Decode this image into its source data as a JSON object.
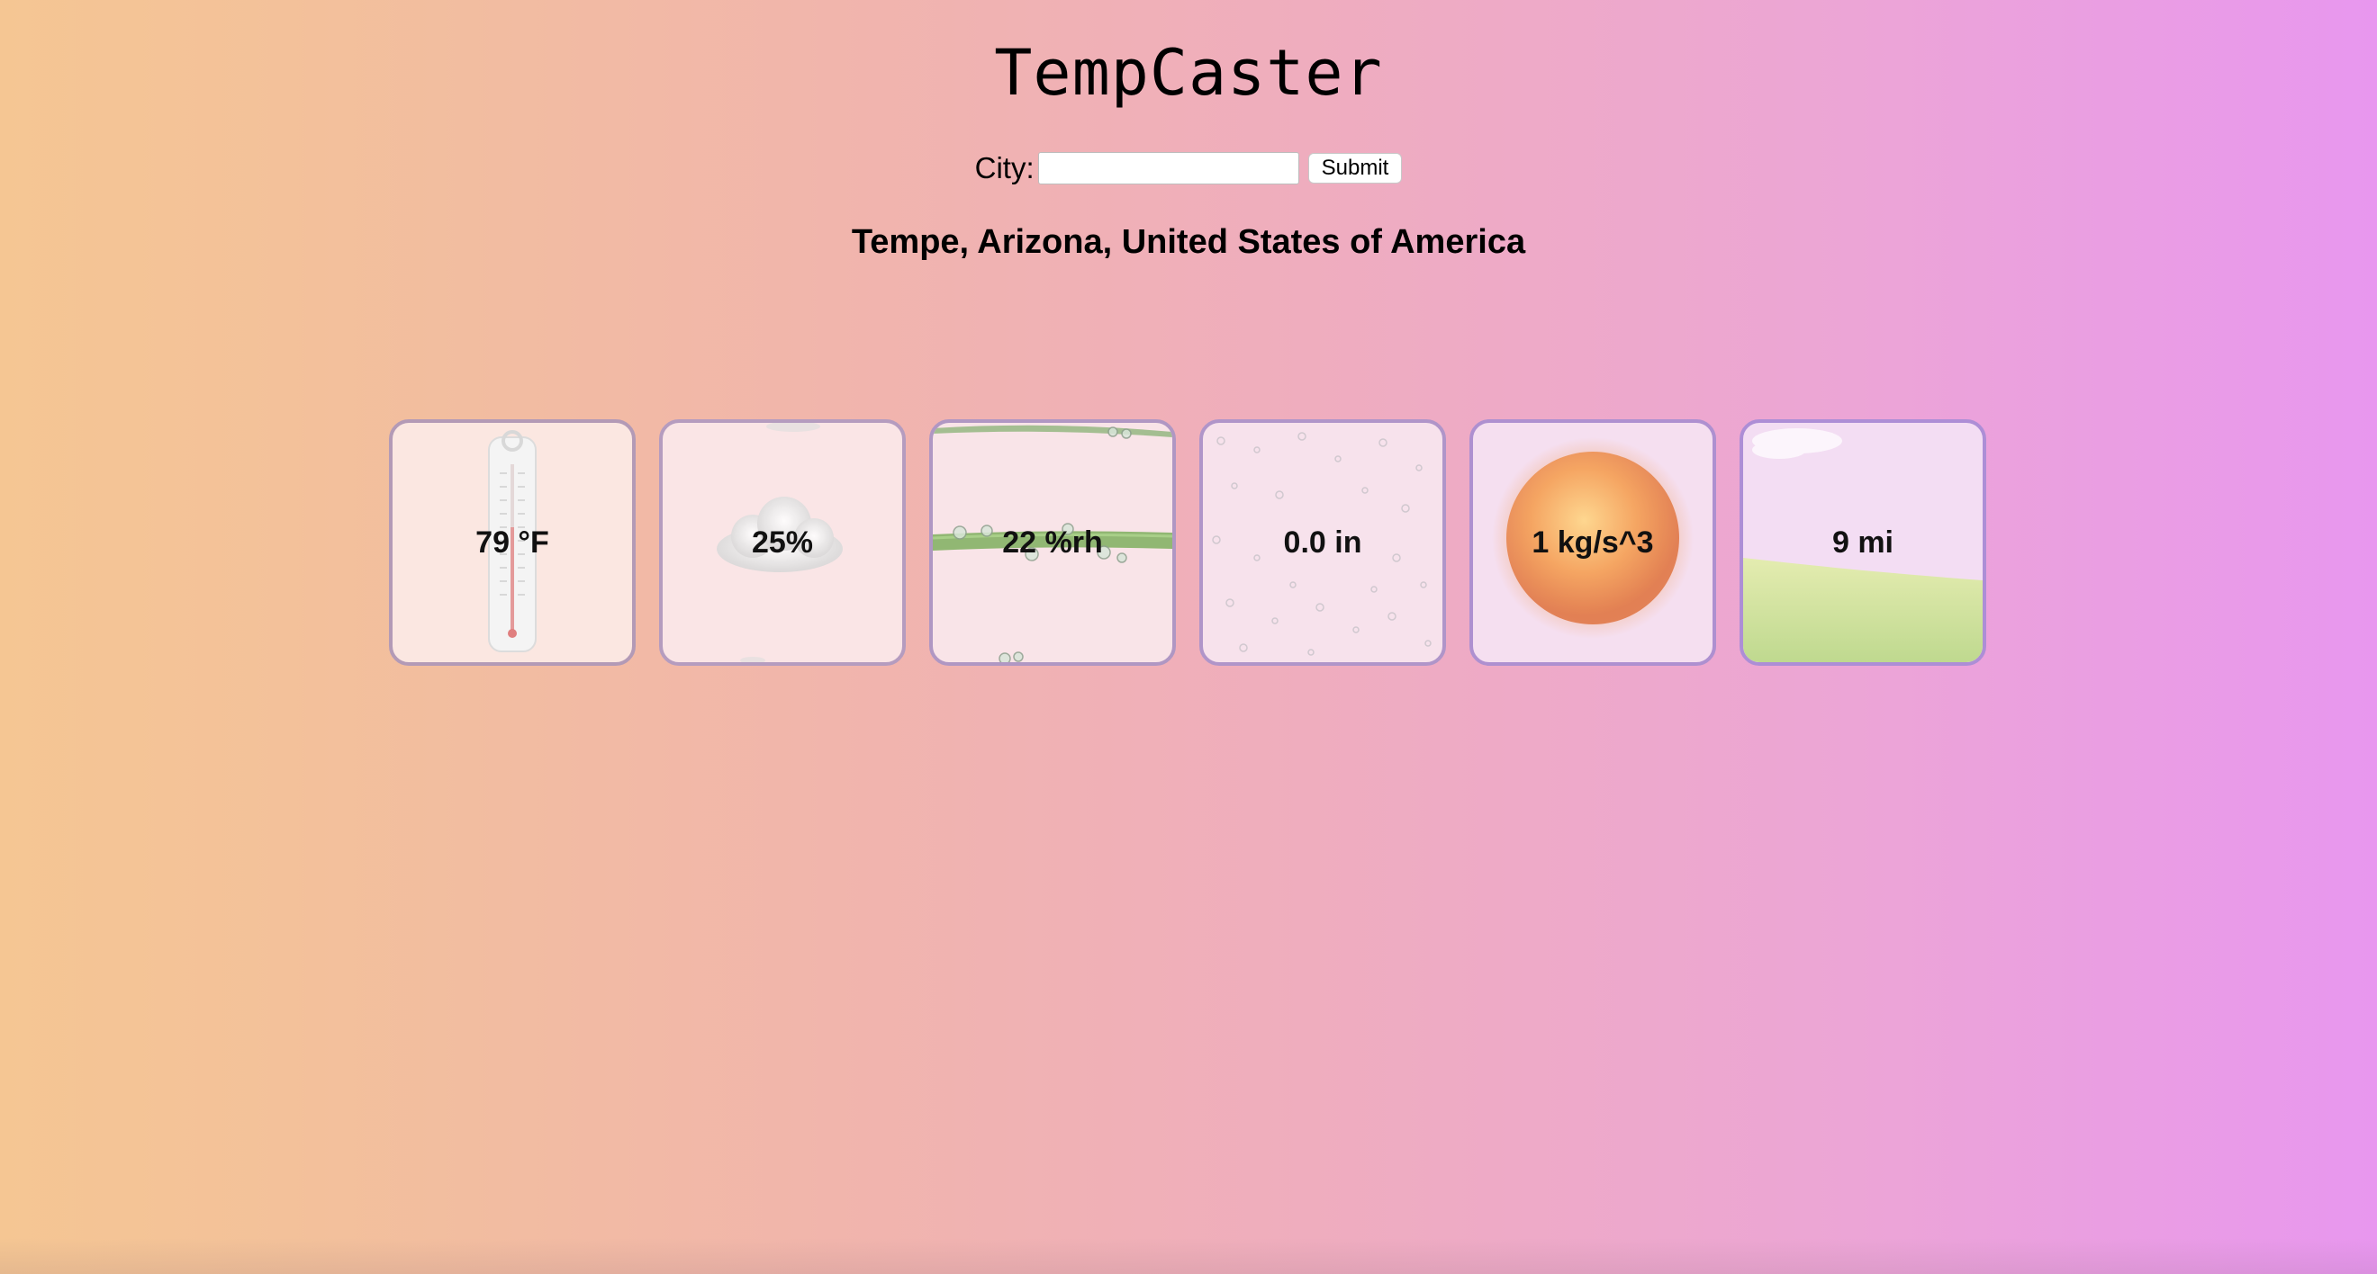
{
  "app": {
    "title": "TempCaster"
  },
  "form": {
    "city_label": "City:",
    "city_value": "",
    "submit_label": "Submit"
  },
  "location": "Tempe, Arizona, United States of America",
  "cards": [
    {
      "value": "79 °F",
      "icon": "thermometer-icon"
    },
    {
      "value": "25%",
      "icon": "cloud-icon"
    },
    {
      "value": "22 %rh",
      "icon": "dewdrop-stem-icon"
    },
    {
      "value": "0.0 in",
      "icon": "raindrops-icon"
    },
    {
      "value": "1 kg/s^3",
      "icon": "sun-icon"
    },
    {
      "value": "9 mi",
      "icon": "field-icon"
    }
  ],
  "colors": {
    "gradient_start": "#f5c693",
    "gradient_end": "#e897ef",
    "card_border": "#b195c0"
  }
}
